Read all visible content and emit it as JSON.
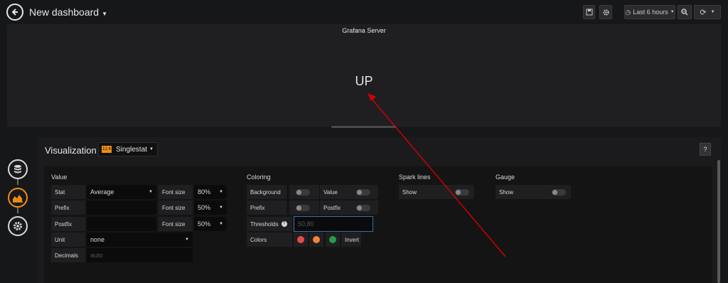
{
  "header": {
    "dashboard_title": "New dashboard",
    "time_range": "Last 6 hours"
  },
  "panel": {
    "title": "Grafana Server",
    "value": "UP"
  },
  "editor": {
    "visualization_label": "Visualization",
    "visualization_type": "Singlestat",
    "help_label": "?",
    "value_section": {
      "heading": "Value",
      "stat_label": "Stat",
      "stat_value": "Average",
      "font_size_label_1": "Font size",
      "font_size_value_1": "80%",
      "prefix_label": "Prefix",
      "prefix_value": "",
      "font_size_label_2": "Font size",
      "font_size_value_2": "50%",
      "postfix_label": "Postfix",
      "postfix_value": "",
      "font_size_label_3": "Font size",
      "font_size_value_3": "50%",
      "unit_label": "Unit",
      "unit_value": "none",
      "decimals_label": "Decimals",
      "decimals_placeholder": "auto"
    },
    "coloring_section": {
      "heading": "Coloring",
      "background_label": "Background",
      "value_label": "Value",
      "prefix_label": "Prefix",
      "postfix_label": "Postfix",
      "thresholds_label": "Thresholds",
      "thresholds_placeholder": "50,80",
      "colors_label": "Colors",
      "color_1": "#e24d42",
      "color_2": "#ef843c",
      "color_3": "#299c46",
      "invert_label": "Invert"
    },
    "spark_section": {
      "heading": "Spark lines",
      "show_label": "Show"
    },
    "gauge_section": {
      "heading": "Gauge",
      "show_label": "Show"
    }
  },
  "annotation_color": "#d40000"
}
